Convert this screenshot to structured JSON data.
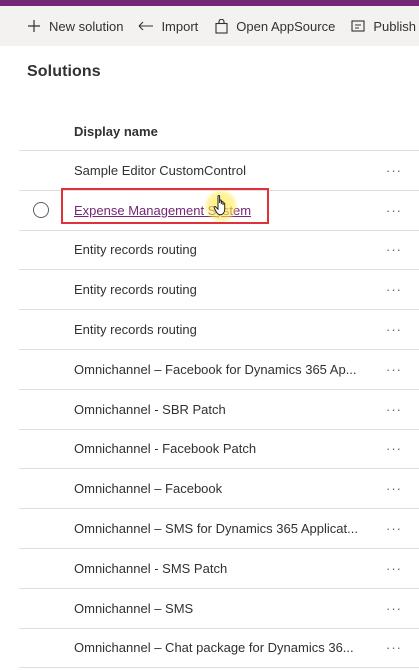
{
  "commandbar": {
    "items": [
      {
        "label": "New solution",
        "icon": "plus-icon"
      },
      {
        "label": "Import",
        "icon": "import-icon"
      },
      {
        "label": "Open AppSource",
        "icon": "shopping-bag-icon"
      },
      {
        "label": "Publish al",
        "icon": "publish-icon"
      }
    ]
  },
  "page": {
    "title": "Solutions"
  },
  "grid": {
    "column_header": "Display name",
    "more_label": "···",
    "rows": [
      {
        "name": "Sample Editor CustomControl"
      },
      {
        "name": "Expense Management System"
      },
      {
        "name": "Entity records routing"
      },
      {
        "name": "Entity records routing"
      },
      {
        "name": "Entity records routing"
      },
      {
        "name": "Omnichannel – Facebook for Dynamics 365 Ap..."
      },
      {
        "name": "Omnichannel - SBR Patch"
      },
      {
        "name": "Omnichannel - Facebook Patch"
      },
      {
        "name": "Omnichannel – Facebook"
      },
      {
        "name": "Omnichannel – SMS for Dynamics 365 Applicat..."
      },
      {
        "name": "Omnichannel - SMS Patch"
      },
      {
        "name": "Omnichannel – SMS"
      },
      {
        "name": "Omnichannel – Chat package for Dynamics 36..."
      }
    ]
  },
  "colors": {
    "brand": "#742774",
    "highlight": "#e0303a",
    "divider": "#e1dfdd"
  }
}
